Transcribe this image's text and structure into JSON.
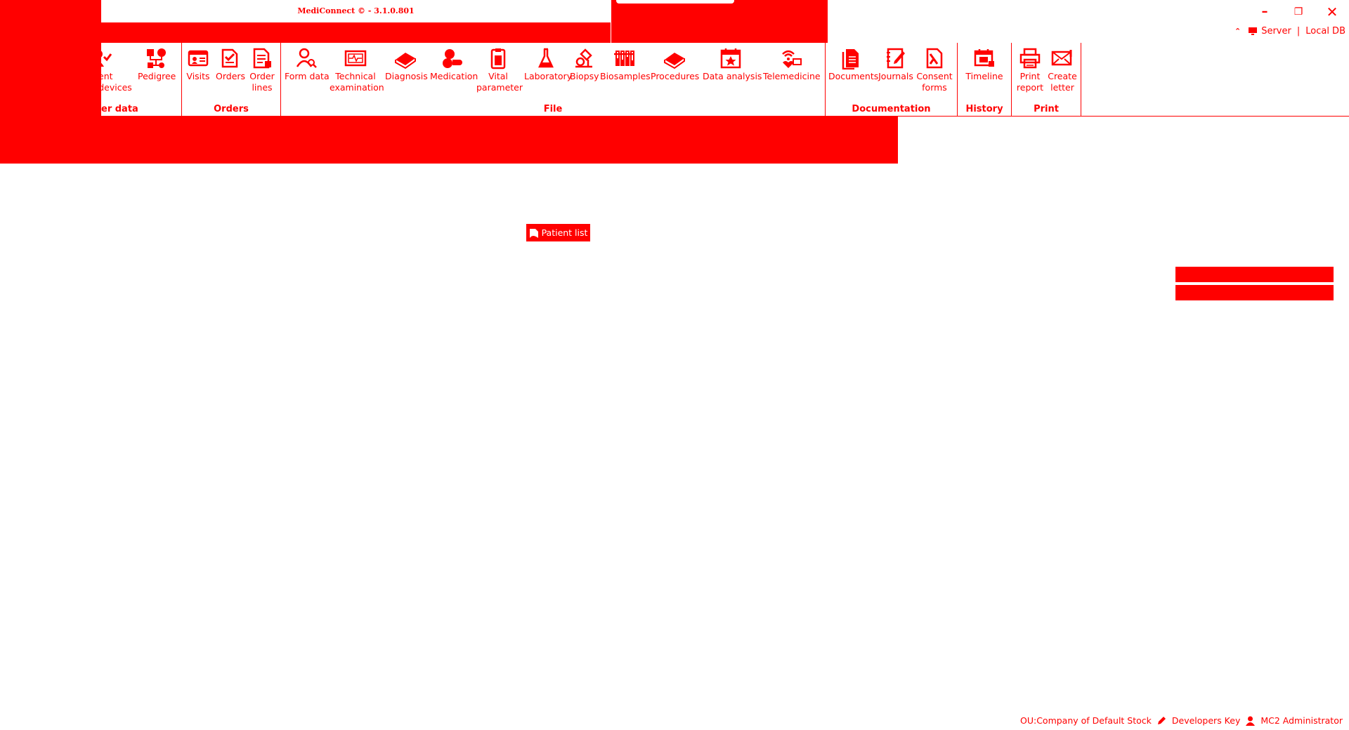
{
  "window": {
    "title": "MediConnect © - 3.1.0.801",
    "minimize_glyph": "–",
    "restore_glyph": "❐",
    "close_glyph": "✕"
  },
  "server_bar": {
    "chevron": "⌃",
    "server_label": "Server",
    "separator": "|",
    "db_label": "Local DB"
  },
  "ribbon": {
    "groups": {
      "master_data": {
        "label": "Master data",
        "items": {
          "patient_devices": "Patient devices",
          "pedigree": "Pedigree"
        }
      },
      "orders": {
        "label": "Orders",
        "items": {
          "visits": "Visits",
          "orders": "Orders",
          "order_lines": "Order lines"
        }
      },
      "file": {
        "label": "File",
        "items": {
          "form_data": "Form data",
          "technical_examination": "Technical examination",
          "diagnosis": "Diagnosis",
          "medication": "Medication",
          "vital_parameter": "Vital parameter",
          "laboratory": "Laboratory",
          "biopsy": "Biopsy",
          "biosamples": "Biosamples",
          "procedures": "Procedures",
          "data_analysis": "Data analysis",
          "telemedicine": "Telemedicine"
        }
      },
      "documentation": {
        "label": "Documentation",
        "items": {
          "documents": "Documents",
          "journals": "Journals",
          "consent_forms": "Consent forms"
        }
      },
      "history": {
        "label": "History",
        "items": {
          "timeline": "Timeline"
        }
      },
      "print": {
        "label": "Print",
        "items": {
          "print_report": "Print report",
          "create_letter": "Create letter"
        }
      }
    },
    "truncated": {
      "patient_devices_line1": "ent",
      "patient_devices_line2": "/devices",
      "master_data_label": "er data"
    }
  },
  "main": {
    "patient_list_label": "Patient list"
  },
  "status_bar": {
    "ou": "OU:Company of Default Stock",
    "key": "Developers Key",
    "user": "MC2 Administrator"
  },
  "colors": {
    "accent": "#ff0000",
    "background": "#ffffff"
  }
}
